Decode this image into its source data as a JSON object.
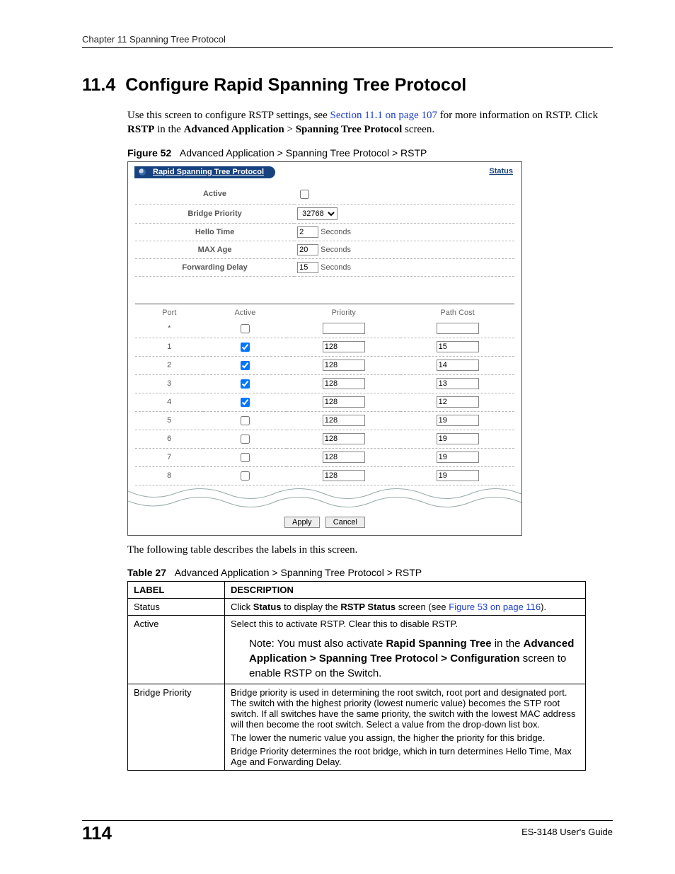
{
  "running_head": "Chapter 11 Spanning Tree Protocol",
  "section": {
    "number": "11.4",
    "title": "Configure Rapid Spanning Tree Protocol"
  },
  "paragraph1_pre": "Use this screen to configure RSTP settings, see ",
  "paragraph1_link": "Section 11.1 on page 107",
  "paragraph1_mid": " for more information on RSTP. Click ",
  "paragraph1_b1": "RSTP",
  "paragraph1_mid2": " in the ",
  "paragraph1_b2": "Advanced Application",
  "paragraph1_gt": " > ",
  "paragraph1_b3": "Spanning Tree Protocol",
  "paragraph1_end": " screen.",
  "figure_caption_label": "Figure 52",
  "figure_caption_text": "Advanced Application > Spanning Tree Protocol > RSTP",
  "fig": {
    "tab": "Rapid Spanning Tree Protocol",
    "status": "Status",
    "labels": {
      "active": "Active",
      "bridge": "Bridge Priority",
      "hello": "Hello Time",
      "max": "MAX Age",
      "fwd": "Forwarding Delay"
    },
    "bridge_value": "32768",
    "hello_value": "2",
    "max_value": "20",
    "fwd_value": "15",
    "seconds": "Seconds",
    "port_headers": {
      "port": "Port",
      "active": "Active",
      "priority": "Priority",
      "path": "Path Cost"
    },
    "ports": [
      {
        "port": "*",
        "active": false,
        "priority": "",
        "path": ""
      },
      {
        "port": "1",
        "active": true,
        "priority": "128",
        "path": "15"
      },
      {
        "port": "2",
        "active": true,
        "priority": "128",
        "path": "14"
      },
      {
        "port": "3",
        "active": true,
        "priority": "128",
        "path": "13"
      },
      {
        "port": "4",
        "active": true,
        "priority": "128",
        "path": "12"
      },
      {
        "port": "5",
        "active": false,
        "priority": "128",
        "path": "19"
      },
      {
        "port": "6",
        "active": false,
        "priority": "128",
        "path": "19"
      },
      {
        "port": "7",
        "active": false,
        "priority": "128",
        "path": "19"
      },
      {
        "port": "8",
        "active": false,
        "priority": "128",
        "path": "19"
      }
    ],
    "apply": "Apply",
    "cancel": "Cancel"
  },
  "paragraph2": "The following table describes the labels in this screen.",
  "table_caption_label": "Table 27",
  "table_caption_text": "Advanced Application > Spanning Tree Protocol > RSTP",
  "desc": {
    "head_label": "LABEL",
    "head_desc": "DESCRIPTION",
    "status": {
      "label": "Status",
      "pre": "Click ",
      "b1": "Status",
      "mid": " to display the ",
      "b2": "RSTP Status",
      "mid2": " screen (see ",
      "link": "Figure 53 on page 116",
      "end": ")."
    },
    "active": {
      "label": "Active",
      "line1": "Select this to activate RSTP. Clear this to disable RSTP.",
      "note_pre": "Note: You must also activate ",
      "note_b1": "Rapid Spanning Tree",
      "note_mid": " in the ",
      "note_b2": "Advanced Application > Spanning Tree Protocol > Configuration",
      "note_end": " screen to enable RSTP on the Switch."
    },
    "bridge": {
      "label": "Bridge Priority",
      "p1": "Bridge priority is used in determining the root switch, root port and designated port. The switch with the highest priority (lowest numeric value) becomes the STP root switch. If all switches have the same priority, the switch with the lowest MAC address will then become the root switch. Select a value from the drop-down list box.",
      "p2": "The lower the numeric value you assign, the higher the priority for this bridge.",
      "p3": "Bridge Priority determines the root bridge, which in turn determines Hello Time, Max Age and Forwarding Delay."
    }
  },
  "footer": {
    "page": "114",
    "guide": "ES-3148 User's Guide"
  }
}
